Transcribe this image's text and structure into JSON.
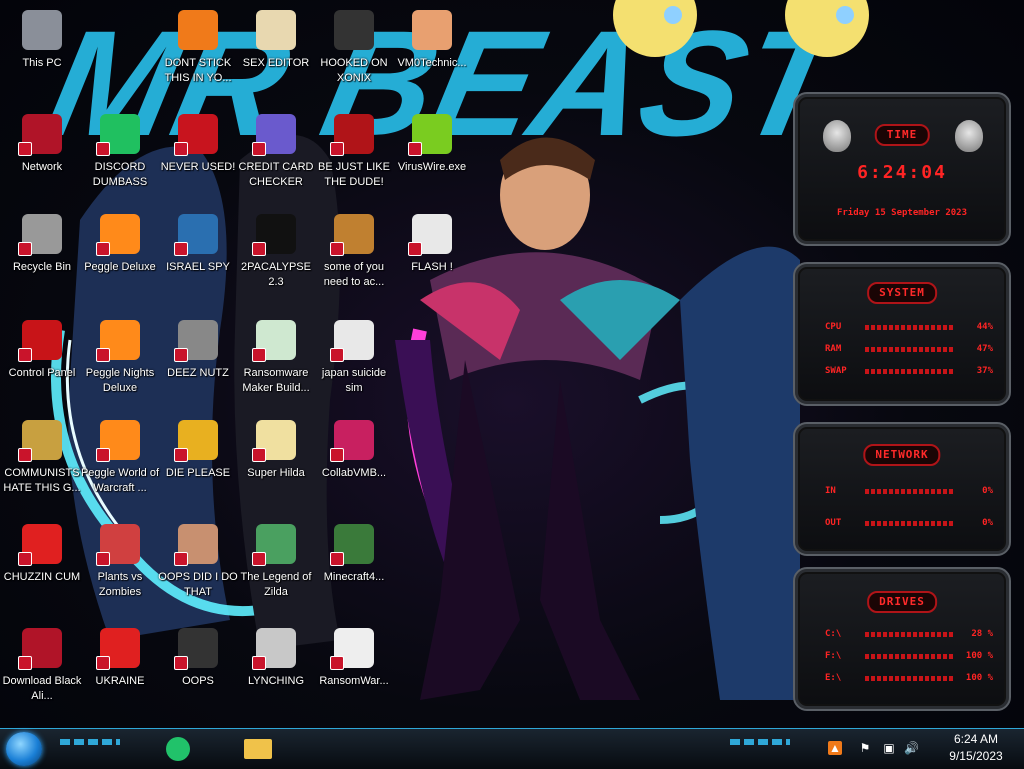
{
  "desktop": {
    "icons": [
      {
        "label": "This PC"
      },
      {
        "label": "DONT STICK THIS IN YO..."
      },
      {
        "label": "SEX EDITOR"
      },
      {
        "label": "HOOKED ON XONIX"
      },
      {
        "label": "VM0Technic..."
      },
      {
        "label": "Network"
      },
      {
        "label": "DISCORD DUMBASS"
      },
      {
        "label": "NEVER USED!"
      },
      {
        "label": "CREDIT CARD CHECKER"
      },
      {
        "label": "BE JUST LIKE THE DUDE!"
      },
      {
        "label": "VirusWire.exe"
      },
      {
        "label": "Recycle Bin"
      },
      {
        "label": "Peggle Deluxe"
      },
      {
        "label": "ISRAEL SPY"
      },
      {
        "label": "2PACALYPSE 2.3"
      },
      {
        "label": "some of you need to ac..."
      },
      {
        "label": "FLASH !"
      },
      {
        "label": "Control Panel"
      },
      {
        "label": "Peggle Nights Deluxe"
      },
      {
        "label": "DEEZ NUTZ"
      },
      {
        "label": "Ransomware Maker Build..."
      },
      {
        "label": "japan suicide sim"
      },
      {
        "label": "COMMUNISTS HATE THIS G..."
      },
      {
        "label": "Peggle World of Warcraft ..."
      },
      {
        "label": "DIE PLEASE"
      },
      {
        "label": "Super Hilda"
      },
      {
        "label": "CollabVMB..."
      },
      {
        "label": "CHUZZIN CUM"
      },
      {
        "label": "Plants vs Zombies"
      },
      {
        "label": "OOPS DID I DO THAT"
      },
      {
        "label": "The Legend of Zilda"
      },
      {
        "label": "Minecraft4..."
      },
      {
        "label": "Download Black Ali..."
      },
      {
        "label": "UKRAINE"
      },
      {
        "label": "OOPS"
      },
      {
        "label": "LYNCHING"
      },
      {
        "label": "RansomWar..."
      }
    ],
    "wallpaper_text": "MR BEAST"
  },
  "gadget": {
    "time_title": "TIME",
    "time": "6:24:04",
    "date": "Friday 15 September 2023",
    "system_title": "SYSTEM",
    "system_rows": [
      {
        "label": "CPU",
        "value": "44%"
      },
      {
        "label": "RAM",
        "value": "47%"
      },
      {
        "label": "SWAP",
        "value": "37%"
      }
    ],
    "network_title": "NETWORK",
    "network_rows": [
      {
        "label": "IN",
        "value": "0%"
      },
      {
        "label": "OUT",
        "value": "0%"
      }
    ],
    "drives_title": "DRIVES",
    "drive_rows": [
      {
        "label": "C:\\",
        "value": "28 %"
      },
      {
        "label": "F:\\",
        "value": "100 %"
      },
      {
        "label": "E:\\",
        "value": "100 %"
      }
    ],
    "accent_color": "#ff2424"
  },
  "taskbar": {
    "clock_time": "6:24 AM",
    "clock_date": "9/15/2023",
    "apps": [
      "discord-app",
      "file-explorer"
    ],
    "accent_color": "#2fa8d8"
  }
}
